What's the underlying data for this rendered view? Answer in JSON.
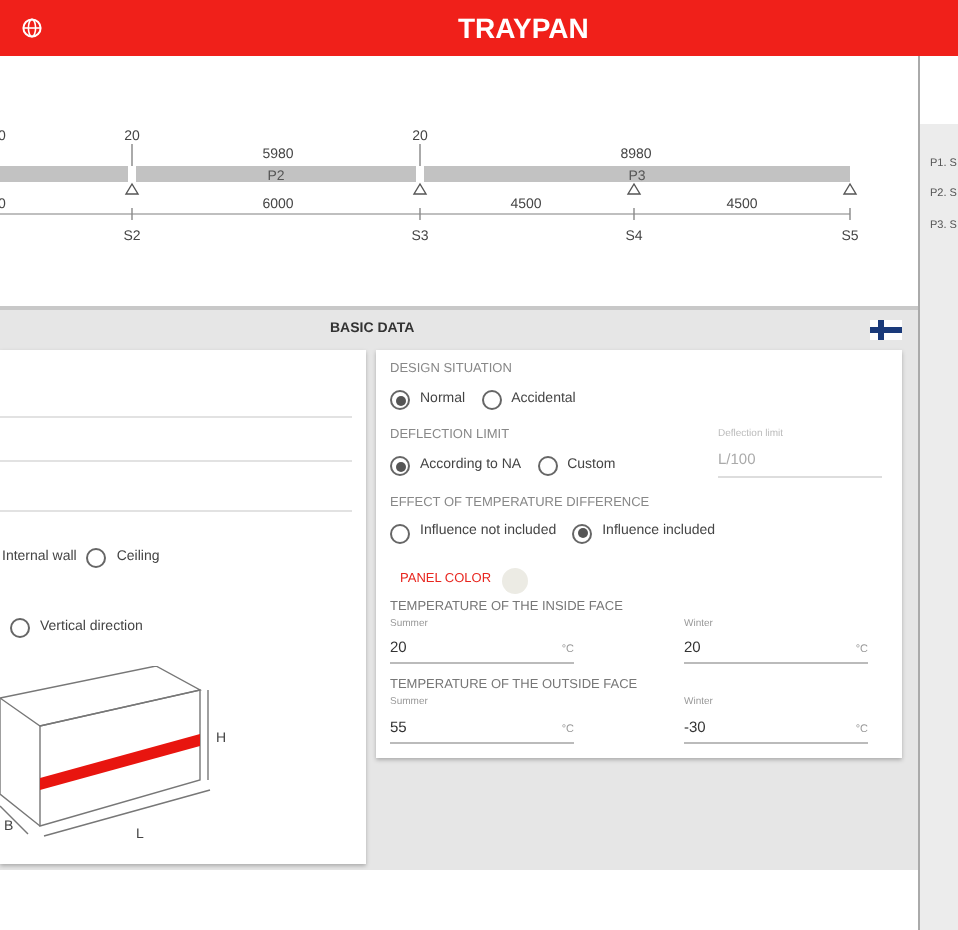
{
  "header": {
    "title": "TRAYPAN"
  },
  "beam": {
    "top_labels": [
      "0",
      "20",
      "5980",
      "20",
      "8980"
    ],
    "panels": [
      "P2",
      "P3"
    ],
    "spans": [
      "0",
      "6000",
      "4500",
      "4500"
    ],
    "supports": [
      "S2",
      "S3",
      "S4",
      "S5"
    ]
  },
  "side_list": {
    "items": [
      "P1. S",
      "P2. S",
      "P3. S"
    ]
  },
  "section": {
    "title": "BASIC DATA"
  },
  "wall_type": {
    "cut_label": "Internal wall",
    "options": [
      {
        "label": "Ceiling",
        "selected": false
      }
    ]
  },
  "direction": {
    "options": [
      {
        "label": "Vertical direction",
        "selected": false
      }
    ]
  },
  "dimension_labels": [
    "H",
    "B",
    "L"
  ],
  "design_situation": {
    "title": "DESIGN SITUATION",
    "options": [
      {
        "label": "Normal",
        "selected": true
      },
      {
        "label": "Accidental",
        "selected": false
      }
    ]
  },
  "deflection_limit": {
    "title": "DEFLECTION LIMIT",
    "options": [
      {
        "label": "According to NA",
        "selected": true
      },
      {
        "label": "Custom",
        "selected": false
      }
    ],
    "field": {
      "label": "Deflection limit",
      "value": "L/100",
      "disabled": true
    }
  },
  "temperature_effect": {
    "title": "EFFECT OF TEMPERATURE DIFFERENCE",
    "options": [
      {
        "label": "Influence not included",
        "selected": false
      },
      {
        "label": "Influence included",
        "selected": true
      }
    ]
  },
  "panel_color": {
    "label": "PANEL COLOR",
    "color": "#ecebe4"
  },
  "inside_face": {
    "title": "TEMPERATURE OF THE INSIDE FACE",
    "fields": [
      {
        "label": "Summer",
        "value": "20",
        "unit": "°C"
      },
      {
        "label": "Winter",
        "value": "20",
        "unit": "°C"
      }
    ]
  },
  "outside_face": {
    "title": "TEMPERATURE OF THE OUTSIDE FACE",
    "fields": [
      {
        "label": "Summer",
        "value": "55",
        "unit": "°C"
      },
      {
        "label": "Winter",
        "value": "-30",
        "unit": "°C"
      }
    ]
  }
}
